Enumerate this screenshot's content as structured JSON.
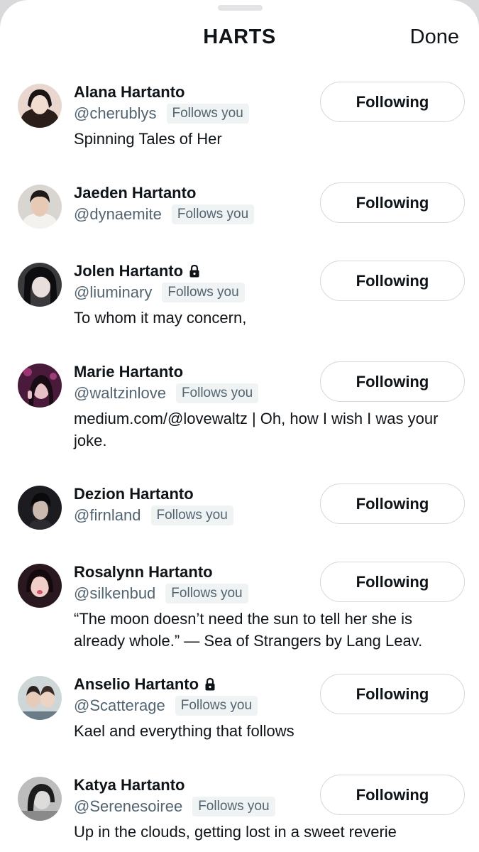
{
  "header": {
    "title": "HARTS",
    "done_label": "Done"
  },
  "users": [
    {
      "name": "Alana Hartanto",
      "handle": "@cherublys",
      "follows_you": "Follows you",
      "bio": "Spinning Tales of Her",
      "button": "Following",
      "locked": false
    },
    {
      "name": "Jaeden Hartanto",
      "handle": "@dynaemite",
      "follows_you": "Follows you",
      "bio": "",
      "button": "Following",
      "locked": false
    },
    {
      "name": "Jolen Hartanto",
      "handle": "@liuminary",
      "follows_you": "Follows you",
      "bio": "To whom it may concern,",
      "button": "Following",
      "locked": true
    },
    {
      "name": "Marie Hartanto",
      "handle": "@waltzinlove",
      "follows_you": "Follows you",
      "bio": "medium.com/@lovewaltz | Oh, how I wish I was your joke.",
      "button": "Following",
      "locked": false
    },
    {
      "name": "Dezion Hartanto",
      "handle": "@firnland",
      "follows_you": "Follows you",
      "bio": "",
      "button": "Following",
      "locked": false
    },
    {
      "name": "Rosalynn Hartanto",
      "handle": "@silkenbud",
      "follows_you": "Follows you",
      "bio": "“The moon doesn’t need the sun to tell her she is already whole.” — Sea of Strangers by Lang Leav.",
      "button": "Following",
      "locked": false
    },
    {
      "name": "Anselio Hartanto",
      "handle": "@Scatterage",
      "follows_you": "Follows you",
      "bio": "Kael and everything that follows",
      "button": "Following",
      "locked": true
    },
    {
      "name": "Katya Hartanto",
      "handle": "@Serenesoiree",
      "follows_you": "Follows you",
      "bio": "Up in the clouds, getting lost in a sweet reverie",
      "button": "Following",
      "locked": false
    }
  ],
  "colors": {
    "text": "#0f1419",
    "secondary": "#536471",
    "badge_bg": "#eff3f4",
    "border": "#cfd9de"
  }
}
